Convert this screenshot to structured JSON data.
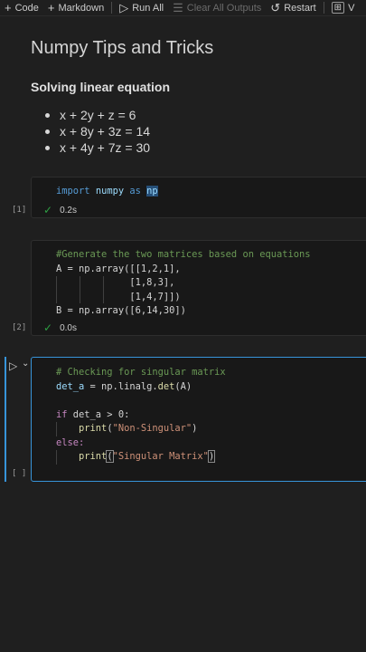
{
  "toolbar": {
    "code_label": "Code",
    "markdown_label": "Markdown",
    "run_all_label": "Run All",
    "clear_label": "Clear All Outputs",
    "restart_label": "Restart",
    "variables_label": "V"
  },
  "markdown": {
    "title": "Numpy Tips and Tricks",
    "subtitle": "Solving linear equation",
    "equations": [
      "x + 2y + z = 6",
      "x + 8y + 3z = 14",
      "x + 4y + 7z = 30"
    ]
  },
  "cells": [
    {
      "exec_count": "[1]",
      "time": "0.2s",
      "code": {
        "kw_import": "import",
        "mod": "numpy",
        "kw_as": "as",
        "alias": "np"
      }
    },
    {
      "exec_count": "[2]",
      "time": "0.0s",
      "code": {
        "comment": "#Generate the two matrices based on equations",
        "line2": "A = np.array([[1,2,1],",
        "line3": "             [1,8,3],",
        "line4": "             [1,4,7]])",
        "line5": "B = np.array([6,14,30])"
      }
    },
    {
      "exec_count": "[ ]",
      "code": {
        "comment": "# Checking for singular matrix",
        "line2_var": "det_a",
        "line2_rest": " = np.linalg.",
        "line2_fn": "det",
        "line2_end": "(A)",
        "if_kw": "if",
        "if_rest": " det_a > 0:",
        "print1_fn": "print",
        "print1_str": "\"Non-Singular\"",
        "else_kw": "else:",
        "print2_fn": "print",
        "print2_str": "\"Singular Matrix\""
      }
    }
  ]
}
